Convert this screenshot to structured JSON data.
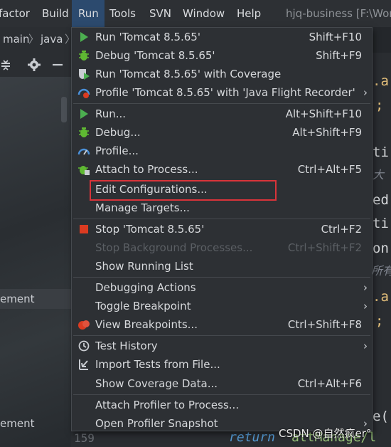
{
  "menubar": {
    "items": [
      "factor",
      "Build",
      "Run",
      "Tools",
      "SVN",
      "Window",
      "Help"
    ],
    "window_title": "hjq-business [F:\\Wor"
  },
  "navbar": {
    "crumb1": "main",
    "crumb2": "java",
    "sep": "〉"
  },
  "tree": {
    "items": [
      "ement",
      "ement"
    ]
  },
  "editor": {
    "line_number": "159",
    "return_kw": "return",
    "return_rest": "attManage/l",
    "frags": [
      ".a",
      ";",
      "ti",
      "大",
      "ed",
      "ti",
      "on",
      "所有",
      ".a",
      ";",
      "e("
    ]
  },
  "run_menu": {
    "items": [
      {
        "label": "Run 'Tomcat 8.5.65'",
        "shortcut": "Shift+F10",
        "icon": "run-icon"
      },
      {
        "label": "Debug 'Tomcat 8.5.65'",
        "shortcut": "Shift+F9",
        "icon": "debug-icon"
      },
      {
        "label": "Run 'Tomcat 8.5.65' with Coverage",
        "shortcut": "",
        "icon": "coverage-icon"
      },
      {
        "label": "Profile 'Tomcat 8.5.65' with 'Java Flight Recorder'",
        "shortcut": "",
        "icon": "profile-jfr-icon",
        "submenu": true
      },
      {
        "label": "Run...",
        "shortcut": "Alt+Shift+F10",
        "icon": "run-icon"
      },
      {
        "label": "Debug...",
        "shortcut": "Alt+Shift+F9",
        "icon": "debug-icon"
      },
      {
        "label": "Profile...",
        "shortcut": "",
        "icon": "profile-icon"
      },
      {
        "label": "Attach to Process...",
        "shortcut": "Ctrl+Alt+F5",
        "icon": "attach-icon"
      },
      {
        "label": "Edit Configurations...",
        "shortcut": "",
        "icon": ""
      },
      {
        "label": "Manage Targets...",
        "shortcut": "",
        "icon": ""
      },
      {
        "label": "Stop 'Tomcat 8.5.65'",
        "shortcut": "Ctrl+F2",
        "icon": "stop-icon"
      },
      {
        "label": "Stop Background Processes...",
        "shortcut": "Ctrl+Shift+F2",
        "icon": "",
        "disabled": true
      },
      {
        "label": "Show Running List",
        "shortcut": "",
        "icon": ""
      },
      {
        "label": "Debugging Actions",
        "shortcut": "",
        "icon": "",
        "submenu": true
      },
      {
        "label": "Toggle Breakpoint",
        "shortcut": "",
        "icon": "",
        "submenu": true
      },
      {
        "label": "View Breakpoints...",
        "shortcut": "Ctrl+Shift+F8",
        "icon": "breakpoints-icon"
      },
      {
        "label": "Test History",
        "shortcut": "",
        "icon": "history-icon",
        "submenu": true
      },
      {
        "label": "Import Tests from File...",
        "shortcut": "",
        "icon": "import-icon"
      },
      {
        "label": "Show Coverage Data...",
        "shortcut": "Ctrl+Alt+F6",
        "icon": ""
      },
      {
        "label": "Attach Profiler to Process...",
        "shortcut": "",
        "icon": ""
      },
      {
        "label": "Open Profiler Snapshot",
        "shortcut": "",
        "icon": "",
        "submenu": true
      }
    ],
    "submenu_arrow": "›"
  },
  "watermark": "CSDN @自然疯er°",
  "colors": {
    "run_green": "#4caf50",
    "debug_green": "#5fb832",
    "stop_red": "#db3b21",
    "highlight_red": "#d9343a",
    "menu_bg": "#2d3034",
    "active_menu": "#2c4a6e"
  }
}
